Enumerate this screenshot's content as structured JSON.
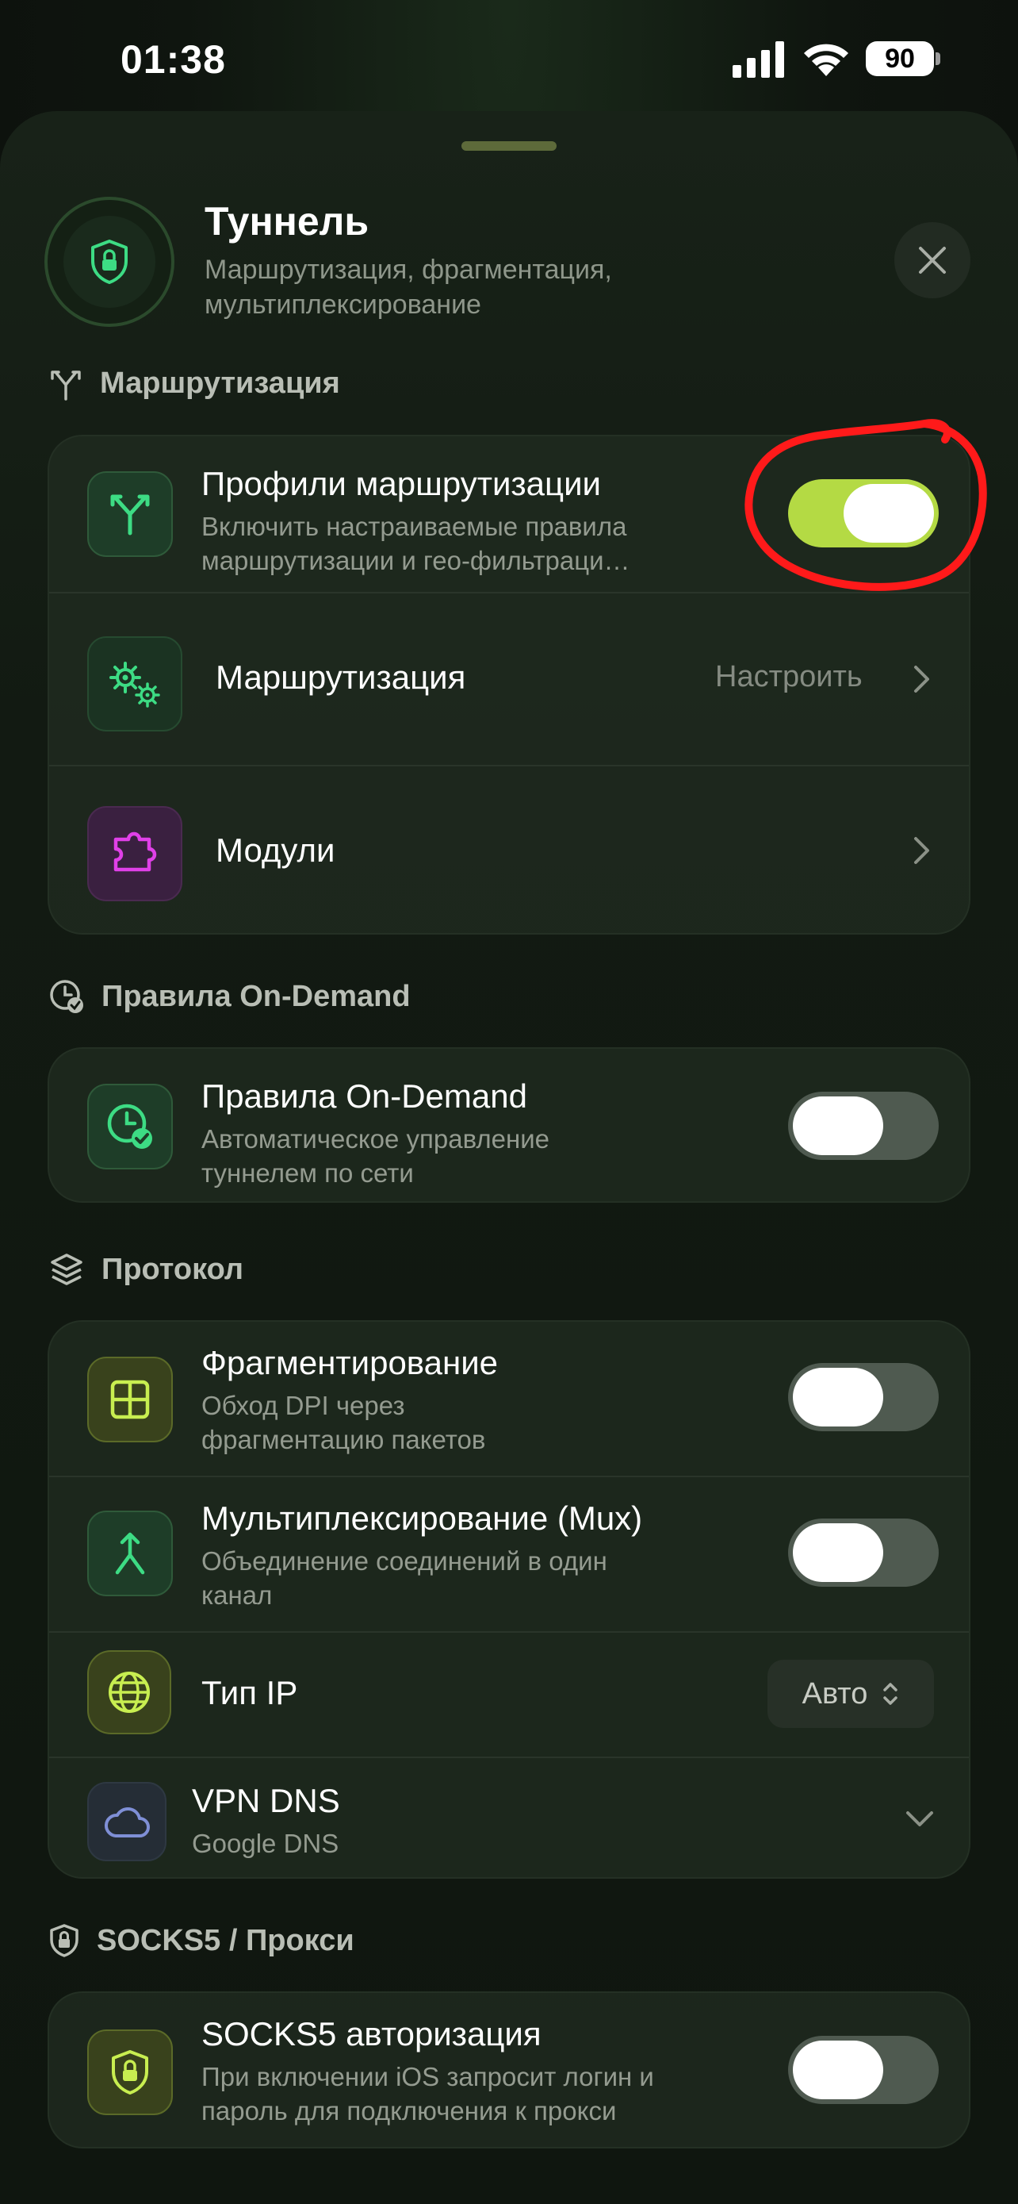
{
  "status_bar": {
    "time": "01:38",
    "battery": "90"
  },
  "sheet": {
    "title": "Туннель",
    "subtitle": "Маршрутизация, фрагментация, мультиплексирование"
  },
  "sections": {
    "routing": {
      "label": "Маршрутизация",
      "profiles": {
        "title": "Профили маршрутизации",
        "subtitle": "Включить настраиваемые правила маршрутизации и гео-фильтраци…",
        "enabled": true
      },
      "routing_row": {
        "title": "Маршрутизация",
        "value": "Настроить"
      },
      "modules_row": {
        "title": "Модули"
      }
    },
    "on_demand": {
      "label": "Правила On-Demand",
      "rules": {
        "title": "Правила On-Demand",
        "subtitle": "Автоматическое управление туннелем по сети",
        "enabled": false
      }
    },
    "protocol": {
      "label": "Протокол",
      "fragmentation": {
        "title": "Фрагментирование",
        "subtitle": "Обход DPI через фрагментацию пакетов",
        "enabled": false
      },
      "mux": {
        "title": "Мультиплексирование (Mux)",
        "subtitle": "Объединение соединений в один канал",
        "enabled": false
      },
      "ip_type": {
        "title": "Тип IP",
        "value": "Авто"
      },
      "vpn_dns": {
        "title": "VPN DNS",
        "value": "Google DNS"
      }
    },
    "socks": {
      "label": "SOCKS5 / Прокси",
      "auth": {
        "title": "SOCKS5 авторизация",
        "subtitle": "При включении iOS запросит логин и пароль для подключения к прокси",
        "enabled": false
      }
    }
  },
  "colors": {
    "accent": "#b4da44",
    "annotation": "#ff1a1a"
  }
}
